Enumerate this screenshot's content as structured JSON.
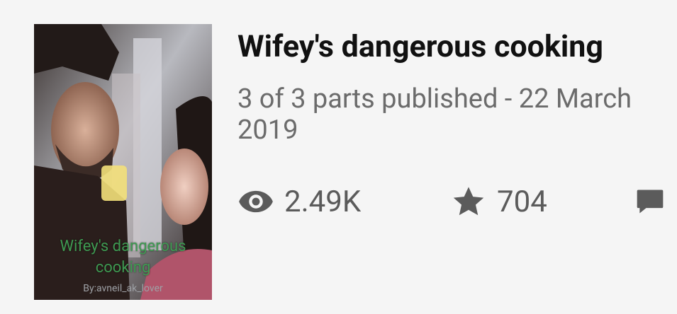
{
  "story": {
    "title": "Wifey's dangerous cooking",
    "parts_status": "3 of 3 parts published - 22 March 2019",
    "cover": {
      "title": "Wifey's dangerous cooking",
      "author": "By:avneil_ak_lover"
    },
    "stats": {
      "views": "2.49K",
      "votes": "704"
    }
  },
  "icons": {
    "views": "eye-icon",
    "votes": "star-icon",
    "comments": "comment-icon"
  },
  "colors": {
    "background": "#f5f5f5",
    "title": "#111111",
    "meta": "#6b6b6b",
    "icon": "#5b5b5b",
    "cover_title": "#3f9a52"
  }
}
